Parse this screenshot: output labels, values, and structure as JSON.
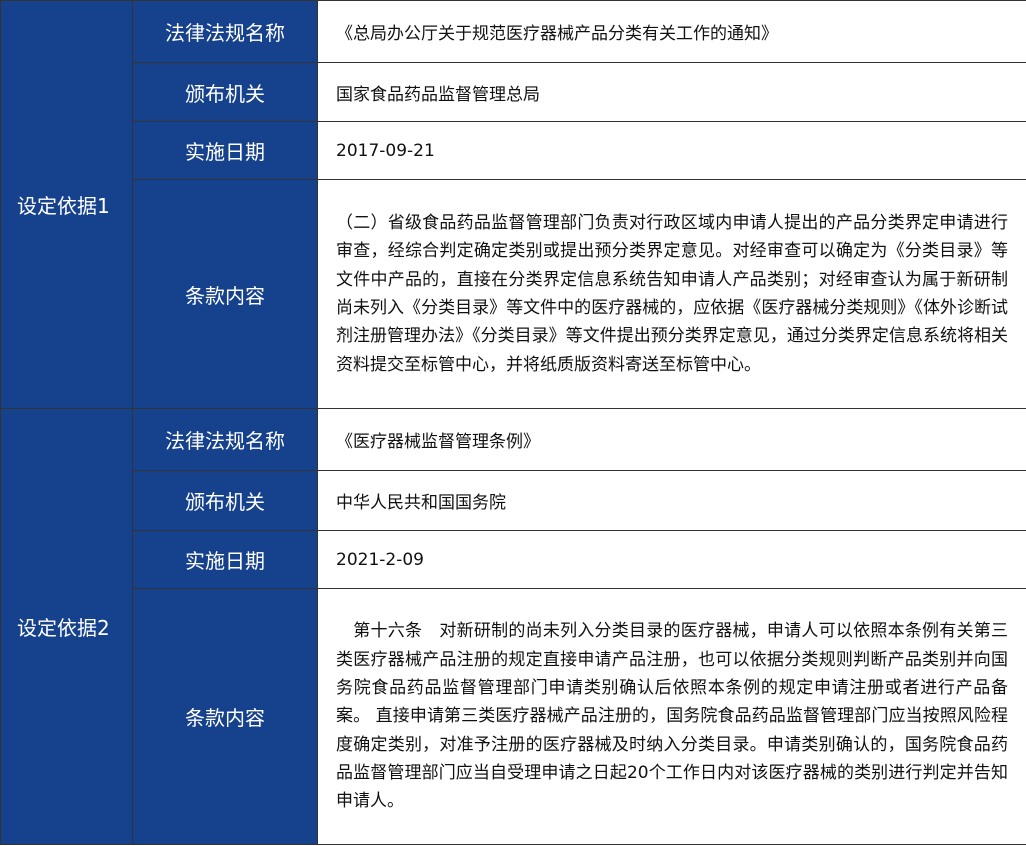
{
  "bases": [
    {
      "group_label": "设定依据1",
      "rows": [
        {
          "label": "法律法规名称",
          "value": "《总局办公厅关于规范医疗器械产品分类有关工作的通知》"
        },
        {
          "label": "颁布机关",
          "value": "国家食品药品监督管理总局"
        },
        {
          "label": "实施日期",
          "value": "2017-09-21"
        },
        {
          "label": "条款内容",
          "value": "（二）省级食品药品监督管理部门负责对行政区域内申请人提出的产品分类界定申请进行审查，经综合判定确定类别或提出预分类界定意见。对经审查可以确定为《分类目录》等文件中产品的，直接在分类界定信息系统告知申请人产品类别；对经审查认为属于新研制尚未列入《分类目录》等文件中的医疗器械的，应依据《医疗器械分类规则》《体外诊断试剂注册管理办法》《分类目录》等文件提出预分类界定意见，通过分类界定信息系统将相关资料提交至标管中心，并将纸质版资料寄送至标管中心。"
        }
      ]
    },
    {
      "group_label": "设定依据2",
      "rows": [
        {
          "label": "法律法规名称",
          "value": "《医疗器械监督管理条例》"
        },
        {
          "label": "颁布机关",
          "value": "中华人民共和国国务院"
        },
        {
          "label": "实施日期",
          "value": "2021-2-09"
        },
        {
          "label": "条款内容",
          "value": "　第十六条　对新研制的尚未列入分类目录的医疗器械，申请人可以依照本条例有关第三类医疗器械产品注册的规定直接申请产品注册，也可以依据分类规则判断产品类别并向国务院食品药品监督管理部门申请类别确认后依照本条例的规定申请注册或者进行产品备案。 直接申请第三类医疗器械产品注册的，国务院食品药品监督管理部门应当按照风险程度确定类别，对准予注册的医疗器械及时纳入分类目录。申请类别确认的，国务院食品药品监督管理部门应当自受理申请之日起20个工作日内对该医疗器械的类别进行判定并告知申请人。"
        }
      ]
    }
  ]
}
